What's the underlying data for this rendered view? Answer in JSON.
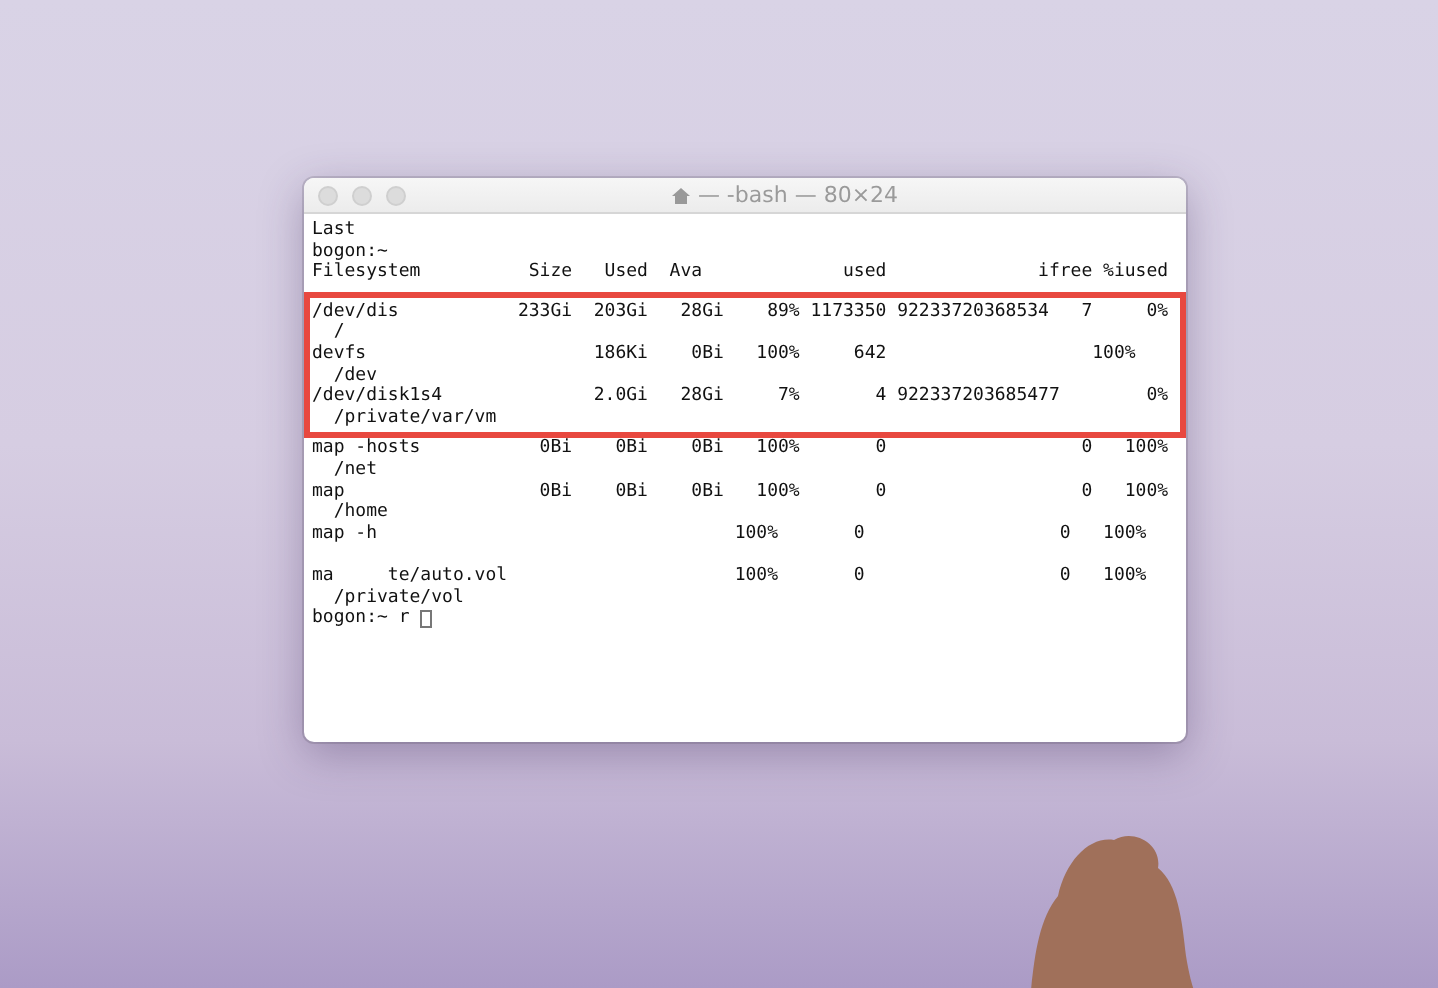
{
  "window": {
    "title": "— -bash — 80×24",
    "active": false
  },
  "lines": [
    {
      "text": "Last",
      "highlighted": false
    },
    {
      "text": "bogon:~",
      "highlighted": false
    },
    {
      "text": "Filesystem          Size   Used  Ava             used              ifree %iused",
      "highlighted": false
    },
    {
      "text": "/dev/dis           233Gi  203Gi   28Gi    89% 1173350 92233720368534   7     0%",
      "highlighted": true
    },
    {
      "text": "  /",
      "highlighted": true
    },
    {
      "text": "devfs                     186Ki    0Bi   100%     642                   100%",
      "highlighted": true
    },
    {
      "text": "  /dev",
      "highlighted": true
    },
    {
      "text": "/dev/disk1s4              2.0Gi   28Gi     7%       4 922337203685477        0%",
      "highlighted": true
    },
    {
      "text": "  /private/var/vm",
      "highlighted": true
    },
    {
      "text": "map -hosts           0Bi    0Bi    0Bi   100%       0                  0   100%",
      "highlighted": false
    },
    {
      "text": "  /net",
      "highlighted": false
    },
    {
      "text": "map                  0Bi    0Bi    0Bi   100%       0                  0   100%",
      "highlighted": false
    },
    {
      "text": "  /home",
      "highlighted": false
    },
    {
      "text": "map -h                                 100%       0                  0   100%",
      "highlighted": false
    },
    {
      "highlighted": false
    },
    {
      "text": "ma     te/auto.vol                     100%       0                  0   100%",
      "highlighted": false
    },
    {
      "text": "  /private/vol",
      "highlighted": false
    }
  ],
  "prompt": {
    "text": "bogon:~ r",
    "cursor": true
  }
}
